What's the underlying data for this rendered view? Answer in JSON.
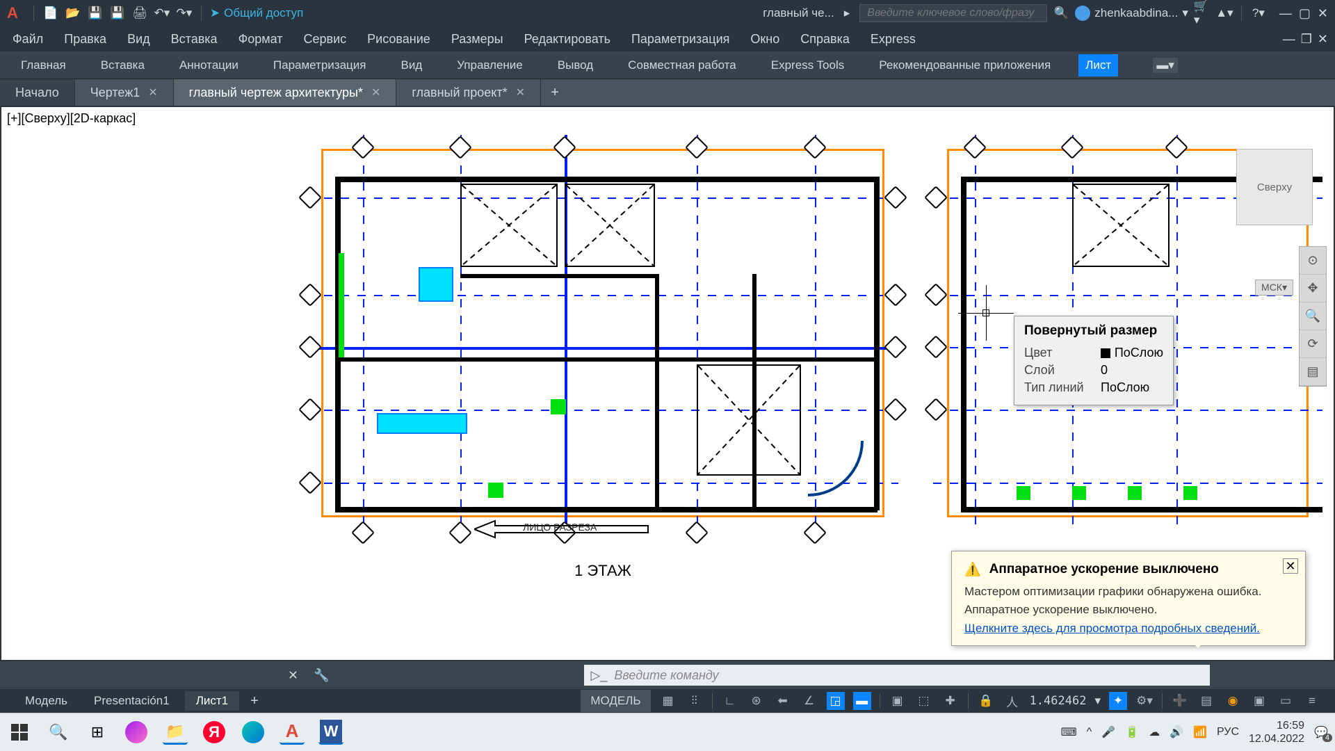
{
  "qat": {
    "share": "Общий доступ",
    "doc_title": "главный че...",
    "search_ph": "Введите ключевое слово/фразу",
    "user": "zhenkaabdina..."
  },
  "menubar": [
    "Файл",
    "Правка",
    "Вид",
    "Вставка",
    "Формат",
    "Сервис",
    "Рисование",
    "Размеры",
    "Редактировать",
    "Параметризация",
    "Окно",
    "Справка",
    "Express"
  ],
  "ribbon": {
    "tabs": [
      "Главная",
      "Вставка",
      "Аннотации",
      "Параметризация",
      "Вид",
      "Управление",
      "Вывод",
      "Совместная работа",
      "Express Tools",
      "Рекомендованные приложения",
      "Лист"
    ],
    "active": 10
  },
  "doctabs": [
    {
      "label": "Начало",
      "type": "start"
    },
    {
      "label": "Чертеж1",
      "closable": true
    },
    {
      "label": "главный чертеж архитектуры*",
      "closable": true,
      "active": true
    },
    {
      "label": "главный проект*",
      "closable": true
    }
  ],
  "viewport_label": "[+][Сверху][2D-каркас]",
  "floor_label": "1 ЭТАЖ",
  "section_label": "ЛИЦО РАЗРЕЗА",
  "viewcube": "Сверху",
  "mcs": "МСК",
  "tooltip": {
    "title": "Повернутый размер",
    "rows": [
      {
        "k": "Цвет",
        "v": "ПоСлою",
        "color": true
      },
      {
        "k": "Слой",
        "v": "0"
      },
      {
        "k": "Тип линий",
        "v": "ПоСлою"
      }
    ]
  },
  "notification": {
    "title": "Аппаратное ускорение выключено",
    "msg1": "Мастером оптимизации графики обнаружена ошибка.",
    "msg2": "Аппаратное ускорение выключено.",
    "link": "Щелкните здесь для просмотра подробных сведений."
  },
  "cmdline": {
    "placeholder": "Введите команду"
  },
  "layouttabs": {
    "tabs": [
      "Модель",
      "Presentación1",
      "Лист1"
    ],
    "active": 2,
    "model_btn": "МОДЕЛЬ",
    "scale": "1.462462"
  },
  "taskbar": {
    "lang": "РУС",
    "time": "16:59",
    "date": "12.04.2022",
    "notif_count": "4"
  }
}
